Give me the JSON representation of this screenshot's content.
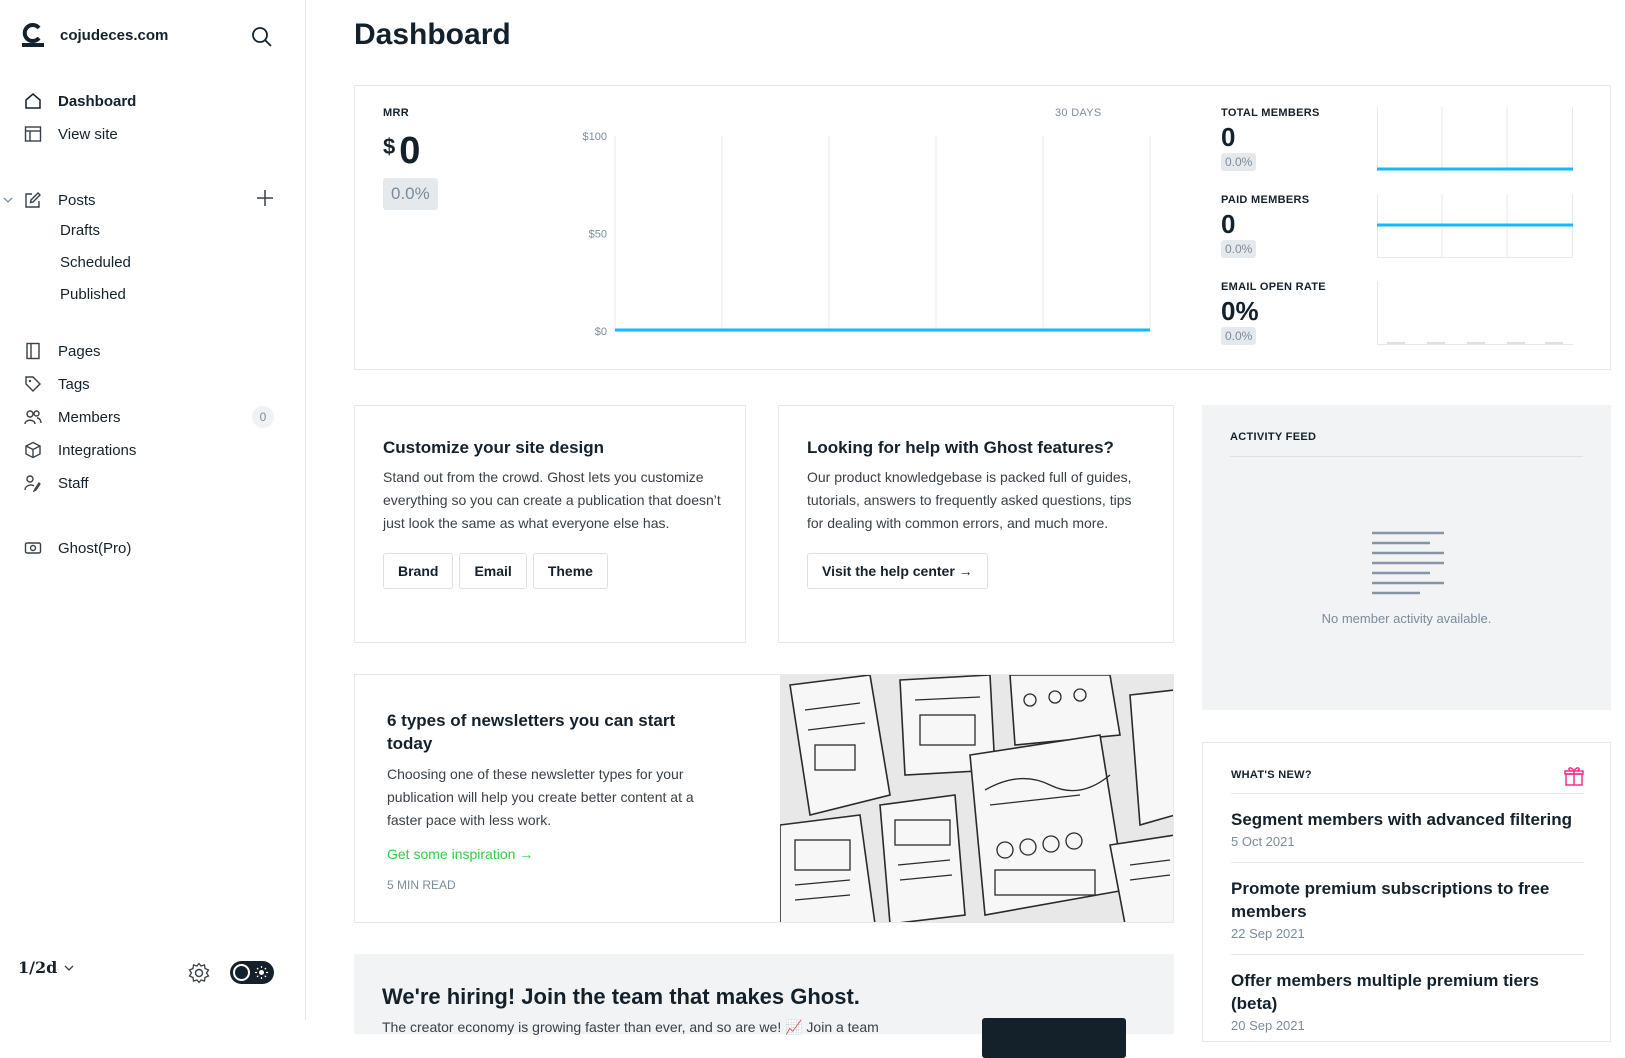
{
  "site": {
    "name": "cojudeces.com"
  },
  "nav": {
    "dashboard": "Dashboard",
    "view_site": "View site",
    "posts": "Posts",
    "drafts": "Drafts",
    "scheduled": "Scheduled",
    "published": "Published",
    "pages": "Pages",
    "tags": "Tags",
    "members": "Members",
    "members_count": "0",
    "integrations": "Integrations",
    "staff": "Staff",
    "ghost_pro": "Ghost(Pro)"
  },
  "user": {
    "avatar_text": "1/2d"
  },
  "page": {
    "title": "Dashboard"
  },
  "mrr": {
    "label": "MRR",
    "currency": "$",
    "value": "0",
    "change": "0.0%",
    "range": "30 DAYS"
  },
  "stats": {
    "total_members": {
      "label": "TOTAL MEMBERS",
      "value": "0",
      "change": "0.0%"
    },
    "paid_members": {
      "label": "PAID MEMBERS",
      "value": "0",
      "change": "0.0%"
    },
    "email_open_rate": {
      "label": "EMAIL OPEN RATE",
      "value": "0%",
      "change": "0.0%"
    }
  },
  "chart_data": {
    "type": "line",
    "title": "MRR",
    "x": [
      1,
      2,
      3,
      4,
      5,
      6
    ],
    "series": [
      {
        "values": [
          0,
          0,
          0,
          0,
          0,
          0
        ]
      }
    ],
    "ytick_labels": [
      "$100",
      "$50",
      "$0"
    ],
    "ylim": [
      0,
      100
    ],
    "grid": true,
    "color": "#14b8ff"
  },
  "customize": {
    "title": "Customize your site design",
    "desc": "Stand out from the crowd. Ghost lets you customize everything so you can create a publication that doesn’t just look the same as what everyone else has.",
    "brand": "Brand",
    "email": "Email",
    "theme": "Theme"
  },
  "help": {
    "title": "Looking for help with Ghost features?",
    "desc": "Our product knowledgebase is packed full of guides, tutorials, answers to frequently asked questions, tips for dealing with common errors, and much more.",
    "button": "Visit the help center →"
  },
  "feed": {
    "title": "ACTIVITY FEED",
    "empty": "No member activity available."
  },
  "article": {
    "title": "6 types of newsletters you can start today",
    "desc": "Choosing one of these newsletter types for your publication will help you create better content at a faster pace with less work.",
    "link": "Get some inspiration →",
    "read": "5 MIN READ"
  },
  "whats_new": {
    "title": "WHAT'S NEW?",
    "items": [
      {
        "title": "Segment members with advanced filtering",
        "date": "5 Oct 2021"
      },
      {
        "title": "Promote premium subscriptions to free members",
        "date": "22 Sep 2021"
      },
      {
        "title": "Offer members multiple premium tiers (beta)",
        "date": "20 Sep 2021"
      }
    ]
  },
  "hiring": {
    "title": "We're hiring! Join the team that makes Ghost.",
    "desc": "The creator economy is growing faster than ever, and so are we! 📈 Join a team"
  },
  "colors": {
    "accent": "#14b8ff",
    "link_green": "#30cf43",
    "gift_pink": "#fb2d8d"
  }
}
